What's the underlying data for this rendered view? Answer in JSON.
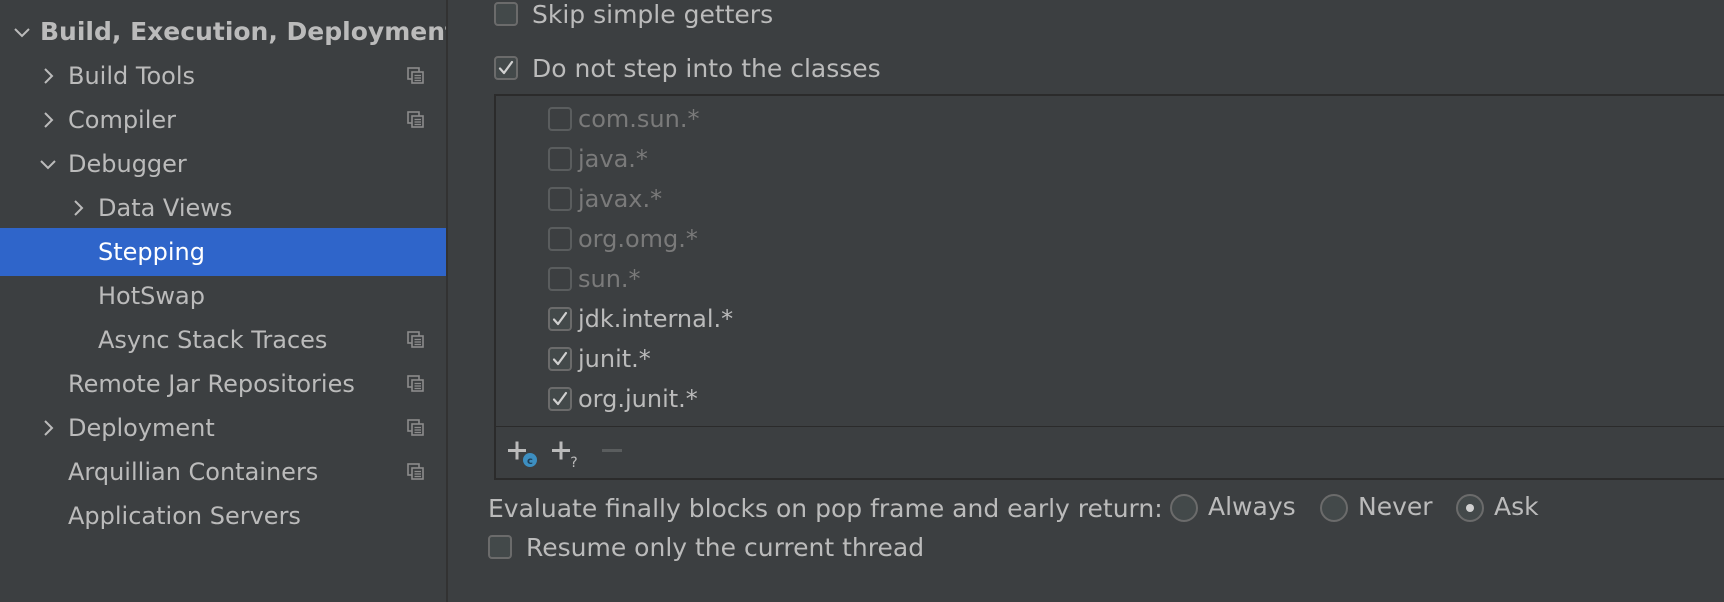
{
  "sidebar": {
    "items": [
      {
        "label": "Build, Execution, Deployment",
        "chevron": "down",
        "project_icon": false,
        "bold": true,
        "selected": false
      },
      {
        "label": "Build Tools",
        "chevron": "right",
        "project_icon": true,
        "bold": false,
        "selected": false
      },
      {
        "label": "Compiler",
        "chevron": "right",
        "project_icon": true,
        "bold": false,
        "selected": false
      },
      {
        "label": "Debugger",
        "chevron": "down",
        "project_icon": false,
        "bold": false,
        "selected": false
      },
      {
        "label": "Data Views",
        "chevron": "right",
        "project_icon": false,
        "bold": false,
        "selected": false
      },
      {
        "label": "Stepping",
        "chevron": "none",
        "project_icon": false,
        "bold": false,
        "selected": true
      },
      {
        "label": "HotSwap",
        "chevron": "none",
        "project_icon": false,
        "bold": false,
        "selected": false
      },
      {
        "label": "Async Stack Traces",
        "chevron": "none",
        "project_icon": true,
        "bold": false,
        "selected": false
      },
      {
        "label": "Remote Jar Repositories",
        "chevron": "none",
        "project_icon": true,
        "bold": false,
        "selected": false
      },
      {
        "label": "Deployment",
        "chevron": "right",
        "project_icon": true,
        "bold": false,
        "selected": false
      },
      {
        "label": "Arquillian Containers",
        "chevron": "none",
        "project_icon": true,
        "bold": false,
        "selected": false
      },
      {
        "label": "Application Servers",
        "chevron": "none",
        "project_icon": false,
        "bold": false,
        "selected": false
      }
    ]
  },
  "options": {
    "skip_simple_getters": {
      "label": "Skip simple getters",
      "checked": false
    },
    "do_not_step_into": {
      "label": "Do not step into the classes",
      "checked": true
    }
  },
  "class_filters": [
    {
      "pattern": "com.sun.*",
      "enabled": false
    },
    {
      "pattern": "java.*",
      "enabled": false
    },
    {
      "pattern": "javax.*",
      "enabled": false
    },
    {
      "pattern": "org.omg.*",
      "enabled": false
    },
    {
      "pattern": "sun.*",
      "enabled": false
    },
    {
      "pattern": "jdk.internal.*",
      "enabled": true
    },
    {
      "pattern": "junit.*",
      "enabled": true
    },
    {
      "pattern": "org.junit.*",
      "enabled": true
    }
  ],
  "toolbar": {
    "add_class": "add-class-icon",
    "add_pattern": "add-pattern-icon",
    "remove": "remove-icon"
  },
  "evaluate_finally": {
    "label": "Evaluate finally blocks on pop frame and early return:",
    "options": [
      "Always",
      "Never",
      "Ask"
    ],
    "selected": "Ask"
  },
  "resume_only_current_thread": {
    "label": "Resume only the current thread",
    "checked": false
  },
  "colors": {
    "background": "#3c3f41",
    "selection": "#2f65ca",
    "text": "#bbbbbb",
    "disabled_text": "#7a7a7a"
  }
}
